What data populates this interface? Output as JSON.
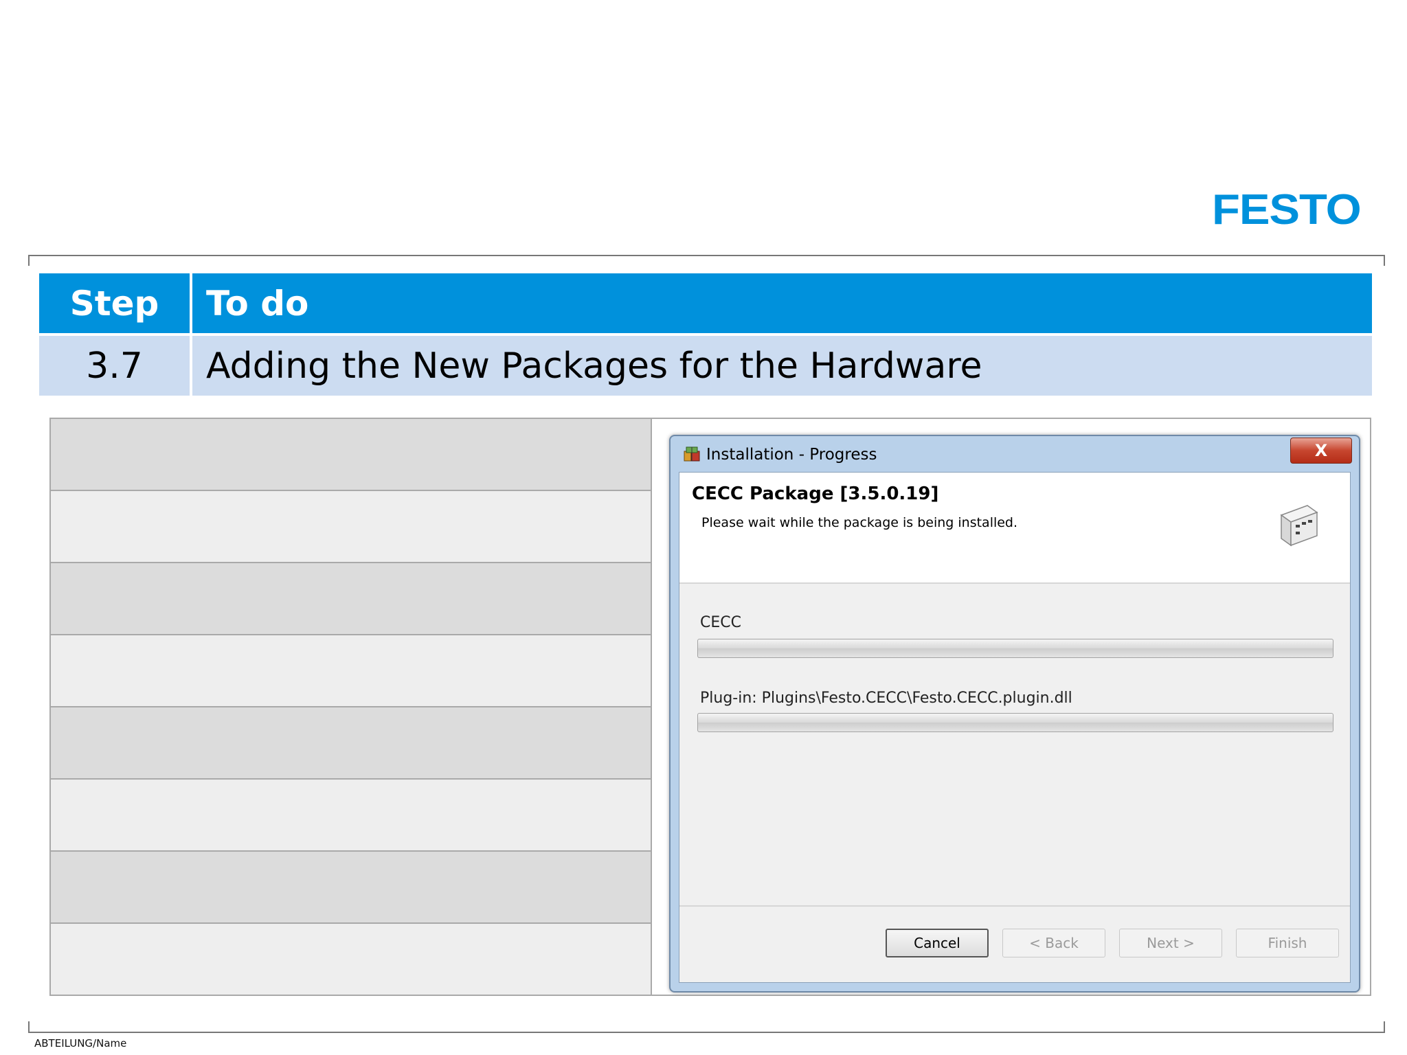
{
  "brand": {
    "logo_text": "FESTO",
    "color": "#0091dc"
  },
  "footer": {
    "text": "ABTEILUNG/Name"
  },
  "step_table": {
    "header": {
      "step": "Step",
      "todo": "To do"
    },
    "row": {
      "step": "3.7",
      "todo": "Adding the New Packages for the Hardware"
    },
    "header_color": "#0091dc",
    "row_color": "#ccdcf1"
  },
  "dialog": {
    "title": "Installation - Progress",
    "close_label": "X",
    "package_title": "CECC Package [3.5.0.19]",
    "package_subtitle": "Please wait while the package is being installed.",
    "progress": [
      {
        "label": "CECC",
        "value": 0
      },
      {
        "label": "Plug-in: Plugins\\Festo.CECC\\Festo.CECC.plugin.dll",
        "value": 0
      }
    ],
    "buttons": {
      "cancel": "Cancel",
      "back": "< Back",
      "next": "Next >",
      "finish": "Finish"
    }
  }
}
